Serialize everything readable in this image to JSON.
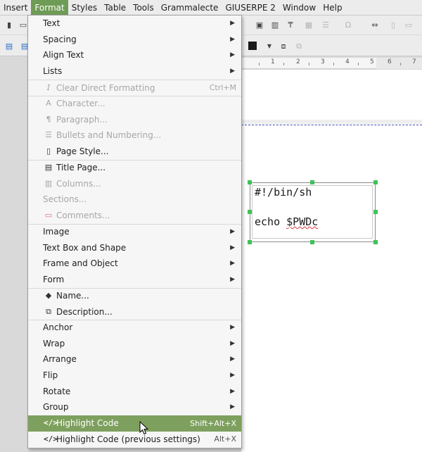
{
  "menubar": {
    "items": [
      "Insert",
      "Format",
      "Styles",
      "Table",
      "Tools",
      "Grammalecte",
      "GIUSERPE 2",
      "Window",
      "Help"
    ],
    "active": "Format"
  },
  "ruler": {
    "numbers": [
      "1",
      "2",
      "3",
      "4",
      "5",
      "6",
      "7"
    ]
  },
  "document": {
    "code_line1": "#!/bin/sh",
    "code_line2_a": "echo ",
    "code_line2_b": "$PWDc"
  },
  "format_menu": {
    "items": [
      {
        "label": "Text",
        "submenu": true
      },
      {
        "label": "Spacing",
        "submenu": true
      },
      {
        "label": "Align Text",
        "submenu": true
      },
      {
        "label": "Lists",
        "submenu": true
      },
      {
        "label": "Clear Direct Formatting",
        "shortcut": "Ctrl+M",
        "icon": "clear-formatting-icon",
        "disabled": true
      },
      {
        "label": "Character...",
        "icon": "character-icon",
        "disabled": true
      },
      {
        "label": "Paragraph...",
        "icon": "paragraph-icon",
        "disabled": true
      },
      {
        "label": "Bullets and Numbering...",
        "icon": "bullets-icon",
        "disabled": true
      },
      {
        "label": "Page Style...",
        "icon": "page-style-icon"
      },
      {
        "label": "Title Page...",
        "icon": "title-page-icon"
      },
      {
        "label": "Columns...",
        "icon": "columns-icon",
        "disabled": true
      },
      {
        "label": "Sections...",
        "disabled": true
      },
      {
        "label": "Comments...",
        "icon": "comments-icon",
        "disabled": true
      },
      {
        "label": "Image",
        "submenu": true
      },
      {
        "label": "Text Box and Shape",
        "submenu": true
      },
      {
        "label": "Frame and Object",
        "submenu": true
      },
      {
        "label": "Form",
        "submenu": true
      },
      {
        "label": "Name...",
        "icon": "tag-icon"
      },
      {
        "label": "Description...",
        "icon": "description-icon"
      },
      {
        "label": "Anchor",
        "submenu": true
      },
      {
        "label": "Wrap",
        "submenu": true
      },
      {
        "label": "Arrange",
        "submenu": true
      },
      {
        "label": "Flip",
        "submenu": true
      },
      {
        "label": "Rotate",
        "submenu": true
      },
      {
        "label": "Group",
        "submenu": true
      },
      {
        "label": "Highlight Code",
        "shortcut": "Shift+Alt+X",
        "icon": "code-icon",
        "highlighted": true
      },
      {
        "label": "Highlight Code (previous settings)",
        "shortcut": "Alt+X",
        "icon": "code-icon"
      }
    ],
    "glyphs": {
      "arrow": "▶",
      "clear": "𝘐",
      "character": "A",
      "paragraph": "¶",
      "bullets": "☰",
      "page": "▯",
      "title": "▤",
      "columns": "▥",
      "comments": "▭",
      "tag": "◆",
      "description": "⧉",
      "code": "</>"
    }
  },
  "colors": {
    "highlight": "#7ea05e",
    "menubar_active": "#6e9b55",
    "handle": "#3ec35a",
    "code_icon": "#2a6fc9"
  }
}
